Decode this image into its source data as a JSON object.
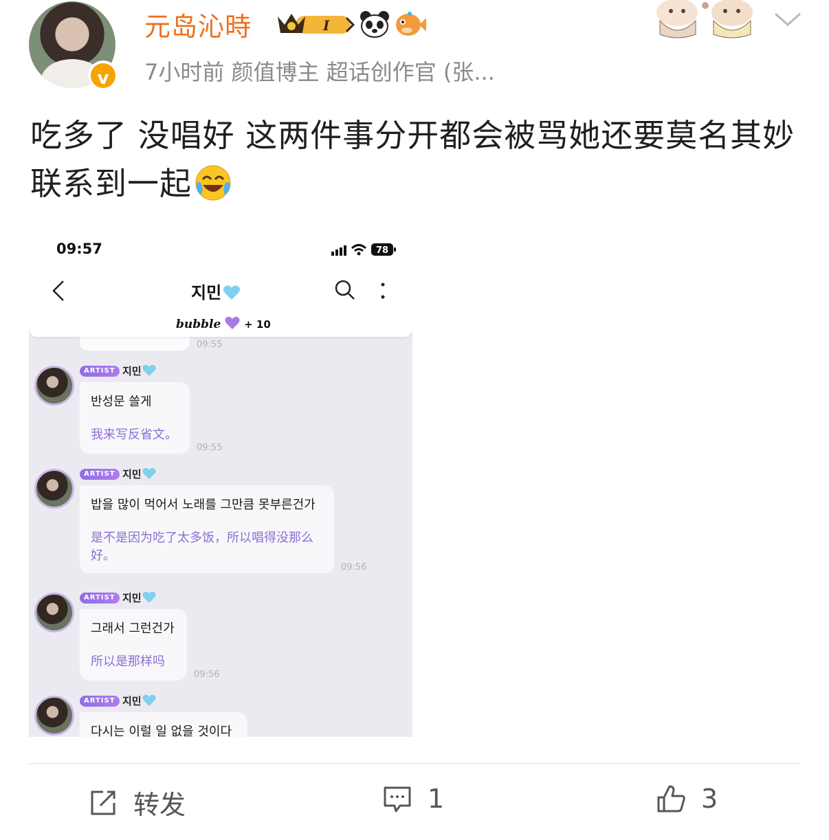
{
  "post": {
    "username": "元岛沁時",
    "member_level": "I",
    "meta": "7小时前  颜值博主 超话创作官 (张...",
    "text": "吃多了 没唱好 这两件事分开都会被骂她还要莫名其妙联系到一起",
    "verified_badge": "v"
  },
  "screenshot": {
    "status_time": "09:57",
    "battery": "78",
    "chat_title": "지민",
    "bubble_label": "bubble",
    "bubble_count": "+ 10",
    "top_timestamp": "09:55",
    "messages": [
      {
        "tag": "ARTIST",
        "sender": "지민",
        "korean": "반성문 쓸게",
        "chinese": "我来写反省文。",
        "time": "09:55"
      },
      {
        "tag": "ARTIST",
        "sender": "지민",
        "korean": "밥을 많이 먹어서 노래를 그만큼 못부른건가",
        "chinese": "是不是因为吃了太多饭，所以唱得没那么好。",
        "time": "09:56"
      },
      {
        "tag": "ARTIST",
        "sender": "지민",
        "korean": "그래서 그런건가",
        "chinese": "所以是那样吗",
        "time": "09:56"
      },
      {
        "tag": "ARTIST",
        "sender": "지민",
        "korean": "다시는 이럴 일 없을 것이다",
        "chinese": "",
        "time": ""
      }
    ]
  },
  "actions": {
    "repost_label": "转发",
    "comment_count": "1",
    "like_count": "3"
  },
  "colors": {
    "username": "#ee6f1f",
    "verified": "#f6a400",
    "translation": "#8b6ed3",
    "artist_tag": "#9a73e8",
    "heart": "#7fd0ee"
  }
}
